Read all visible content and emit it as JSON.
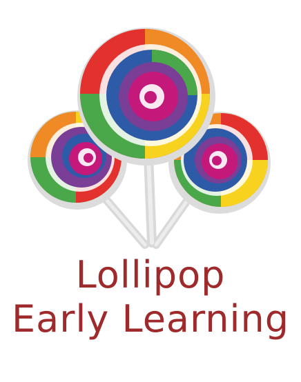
{
  "brand": {
    "name_line1": "Lollipop",
    "name_line2": "Early Learning",
    "text_color": "#9e2a2b"
  },
  "logo": {
    "icon": "lollipop-bouquet-icon",
    "lollipop_count": 3,
    "stick_color": "#e3e3e3",
    "swirl_colors": [
      "#e3322e",
      "#f08a24",
      "#f7d21e",
      "#4aa84a",
      "#2e5ba8",
      "#7a3e97",
      "#c4187a"
    ]
  }
}
